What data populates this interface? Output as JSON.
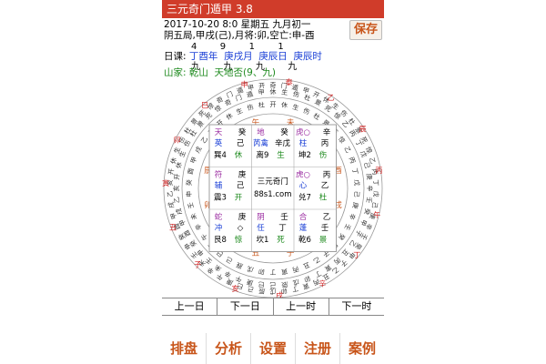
{
  "app": {
    "title": "三元奇门遁甲 3.8",
    "save_label": "保存"
  },
  "header": {
    "line1": "2017-10-20 8:0 星期五 九月初一",
    "line2": "阴五局,甲戌(己),月将:卯,空亡:申-酉",
    "line3_numbers": "4        9        1        1",
    "line4_prefix": "日课: ",
    "line4_pillars": "丁酉年  庚戌月  庚辰日  庚辰时",
    "line5_numbers": "九        九        九        九",
    "line6": "山家: 乾山  天地否(9、九)"
  },
  "board": {
    "outer_ring": [
      "寅",
      "卯",
      "辰",
      "巳",
      "午",
      "未",
      "申",
      "酉",
      "戌",
      "亥",
      "子",
      "丑"
    ],
    "inner_ring": [
      "艮",
      "震",
      "巽",
      "丙",
      "丁",
      "坤",
      "兑",
      "乾",
      "壬",
      "癸",
      "乙",
      "庚",
      "辛",
      "己",
      "戊"
    ],
    "outer_band": "奇门遁甲开休生伤杜景死惊乙丙丁戊己庚辛壬癸甲子乙丑丙寅丁卯戊辰己巳庚午辛未壬申癸酉甲戌乙亥开休生伤杜景死惊",
    "red_marks": [
      "泰",
      "乙",
      "辰",
      "丙",
      "午",
      "丁",
      "辛",
      "戌",
      "亥",
      "子",
      "丑",
      "寅",
      "卯",
      "巳",
      "申"
    ],
    "palaces": [
      {
        "god": "天",
        "star": "英",
        "gate": "休",
        "mid": "己",
        "hs": "癸",
        "bot": "巽4",
        "col": "purple"
      },
      {
        "god": "地",
        "star": "芮禽",
        "gate": "生",
        "mid": "辛戊",
        "hs": "癸",
        "bot": "离9",
        "col": "purple"
      },
      {
        "god": "虎○",
        "star": "柱",
        "gate": "伤",
        "mid": "丙",
        "hs": "辛",
        "bot": "坤2",
        "col": "purple"
      },
      {
        "god": "符",
        "star": "辅",
        "gate": "开",
        "mid": "己",
        "hs": "庚",
        "bot": "震3",
        "col": "purple"
      },
      {
        "god": "",
        "star": "三元奇门",
        "gate": "88s1.com",
        "mid": "",
        "hs": "",
        "bot": "",
        "col": "black"
      },
      {
        "god": "虎○",
        "star": "心",
        "gate": "杜",
        "mid": "乙",
        "hs": "丙",
        "bot": "兑7",
        "col": "purple"
      },
      {
        "god": "蛇",
        "star": "冲",
        "gate": "惊",
        "mid": "◇",
        "hs": "庚",
        "bot": "艮8",
        "col": "purple"
      },
      {
        "god": "阴",
        "star": "任",
        "gate": "死",
        "mid": "丁",
        "hs": "壬",
        "bot": "坎1",
        "col": "purple"
      },
      {
        "god": "合",
        "star": "蓬",
        "gate": "景",
        "mid": "壬",
        "hs": "乙",
        "bot": "乾6",
        "col": "purple"
      }
    ]
  },
  "nav": {
    "prev_day": "上一日",
    "next_day": "下一日",
    "prev_hour": "上一时",
    "next_hour": "下一时"
  },
  "tabs": [
    "排盘",
    "分析",
    "设置",
    "注册",
    "案例"
  ],
  "colors": {
    "accent": "#c8551a",
    "titlebar": "#d03c2a",
    "pillar_blue": "#1a3fd6",
    "green": "#1e8a1e"
  }
}
